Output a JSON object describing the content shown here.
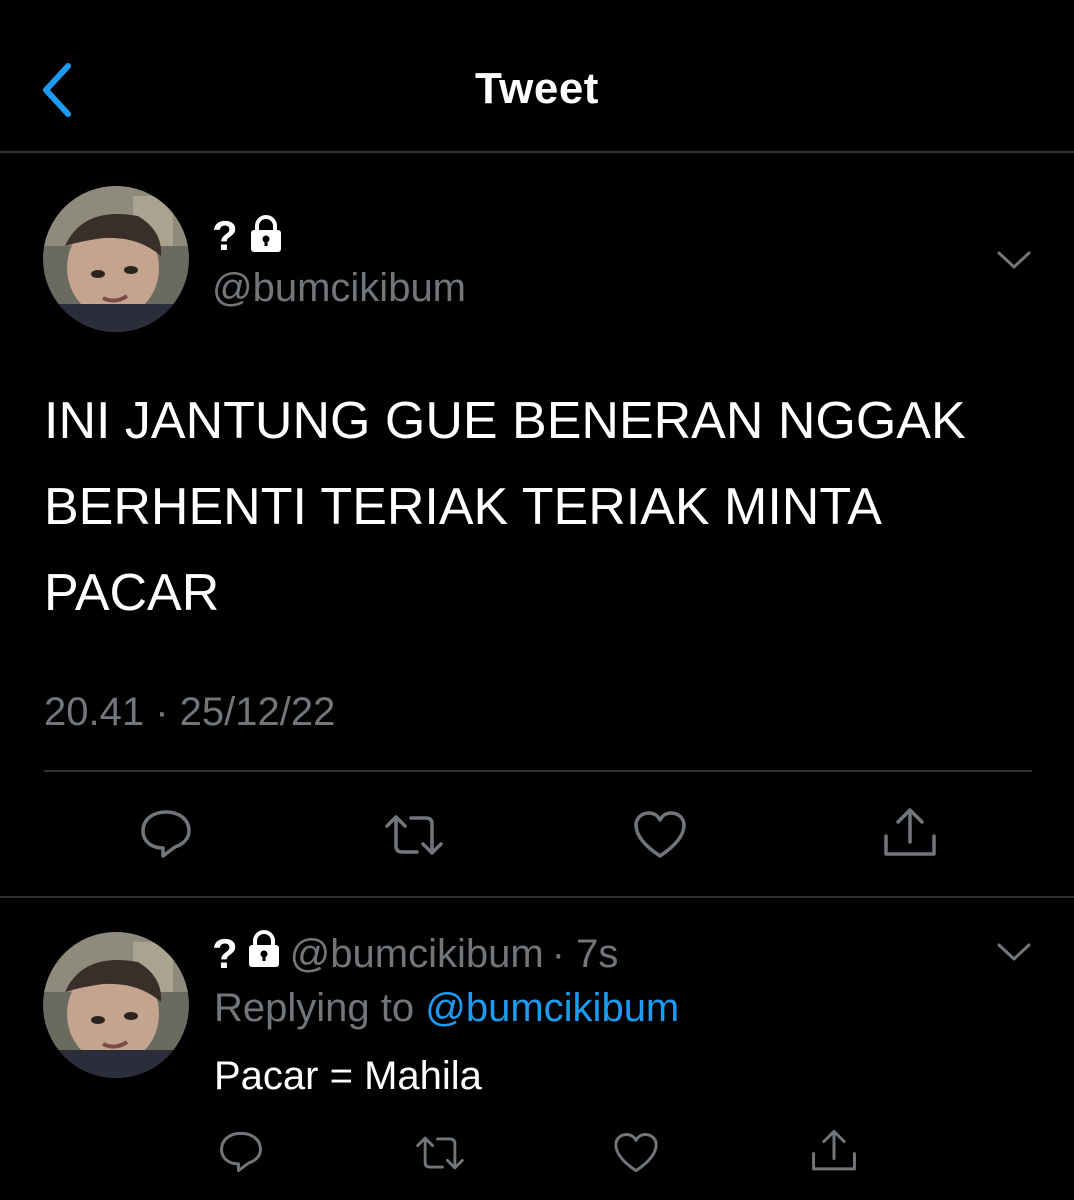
{
  "header": {
    "title": "Tweet",
    "back_icon": "chevron-left-icon",
    "accent": "#1d9bf0"
  },
  "tweet": {
    "display_name": "?",
    "handle": "@bumcikibum",
    "lines": [
      "INI JANTUNG GUE BENERAN NGGAK",
      "BERHENTI TERIAK TERIAK MINTA",
      "PACAR"
    ],
    "timestamp": "20.41 · 25/12/22",
    "actions": [
      "reply-icon",
      "retweet-icon",
      "like-icon",
      "share-icon"
    ]
  },
  "reply": {
    "display_name": "?",
    "handle": "@bumcikibum",
    "time": "· 7s",
    "replying_prefix": "Replying to",
    "replying_to": "@bumcikibum",
    "text": "Pacar = Mahila",
    "actions": [
      "reply-icon",
      "retweet-icon",
      "like-icon",
      "share-icon"
    ]
  },
  "colors": {
    "background": "#000000",
    "secondary_text": "#71767b",
    "link": "#1d9bf0",
    "divider": "#2f3336"
  }
}
